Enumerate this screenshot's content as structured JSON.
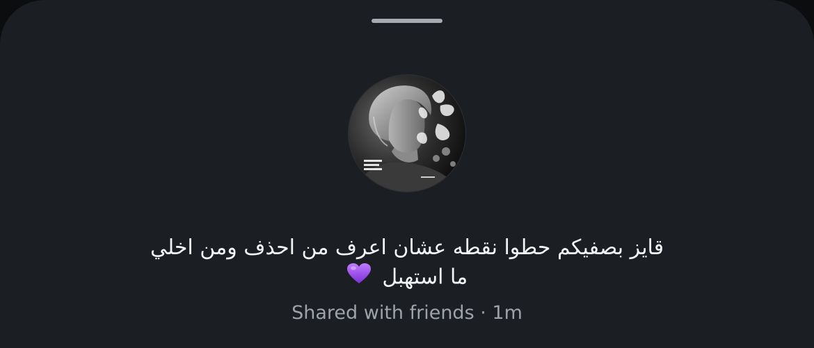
{
  "story": {
    "line1": "قايز بصفيكم حطوا نقطه عشان اعرف من احذف ومن اخلي",
    "line2": "ما استهبل",
    "emoji": "purple-heart",
    "audience": "Shared with friends",
    "separator": "·",
    "time": "1m"
  },
  "icons": {
    "heart": "purple-heart-icon"
  },
  "colors": {
    "background": "#1b1e22",
    "text": "#f3f4f6",
    "meta_text": "#9ea3aa",
    "heart": "#9b4dea"
  }
}
